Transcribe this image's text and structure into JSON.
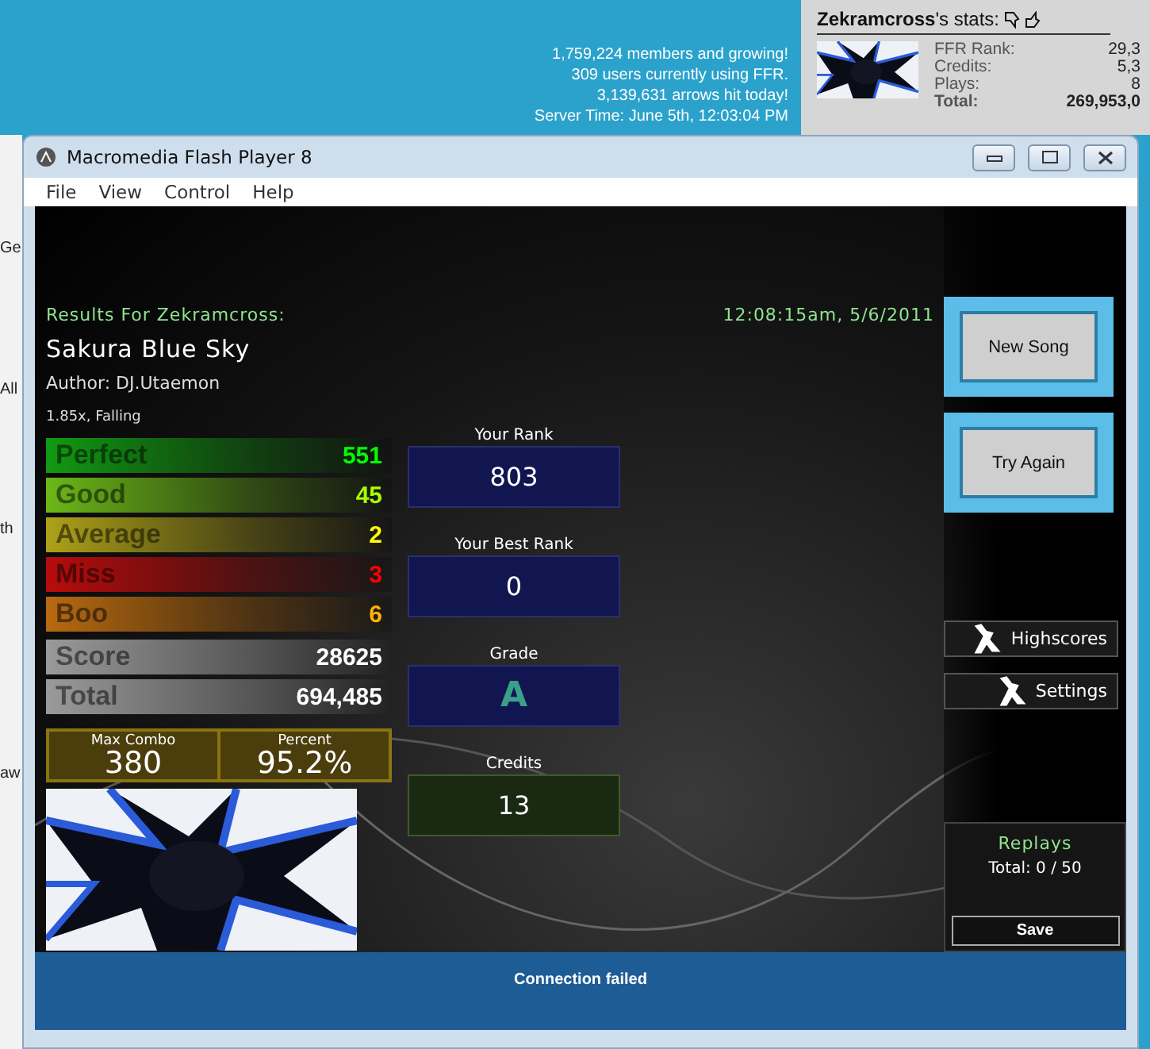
{
  "site": {
    "fragments": [
      "Ge",
      "All",
      "th",
      "aw"
    ],
    "stats_lines": [
      "1,759,224 members and growing!",
      "309 users currently using FFR.",
      "3,139,631 arrows hit today!",
      "Server Time: June 5th, 12:03:04 PM"
    ],
    "user_stats": {
      "username": "Zekramcross",
      "suffix": "'s stats:",
      "rows": [
        {
          "label": "FFR Rank:",
          "value": "29,3",
          "bold": false
        },
        {
          "label": "Credits:",
          "value": "5,3",
          "bold": false
        },
        {
          "label": "Plays:",
          "value": "8",
          "bold": false
        },
        {
          "label": "Total:",
          "value": "269,953,0",
          "bold": true
        }
      ]
    }
  },
  "window": {
    "title": "Macromedia Flash Player 8",
    "menu": [
      "File",
      "View",
      "Control",
      "Help"
    ]
  },
  "game": {
    "results_for": "Results For Zekramcross:",
    "timestamp": "12:08:15am, 5/6/2011",
    "song_title": "Sakura Blue Sky",
    "author": "Author: DJ.Utaemon",
    "settings": "1.85x, Falling",
    "judgments": [
      {
        "label": "Perfect",
        "value": "551",
        "color": "#129a12"
      },
      {
        "label": "Good",
        "value": "45",
        "color": "#6cb818"
      },
      {
        "label": "Average",
        "value": "2",
        "color": "#aea11a"
      },
      {
        "label": "Miss",
        "value": "3",
        "color": "#b80c0c"
      },
      {
        "label": "Boo",
        "value": "6",
        "color": "#b86a10"
      }
    ],
    "totals": [
      {
        "label": "Score",
        "value": "28625"
      },
      {
        "label": "Total",
        "value": "694,485"
      }
    ],
    "summary": [
      {
        "label": "Max Combo",
        "value": "380"
      },
      {
        "label": "Percent",
        "value": "95.2%"
      }
    ],
    "ranks": [
      {
        "label": "Your Rank",
        "value": "803",
        "kind": "rank"
      },
      {
        "label": "Your Best Rank",
        "value": "0",
        "kind": "rank"
      },
      {
        "label": "Grade",
        "value": "A",
        "kind": "grade"
      },
      {
        "label": "Credits",
        "value": "13",
        "kind": "credits"
      }
    ],
    "buttons": [
      {
        "label": "New Song",
        "kind": "large"
      },
      {
        "label": "Try Again",
        "kind": "large"
      },
      {
        "label": "Highscores",
        "kind": "small"
      },
      {
        "label": "Settings",
        "kind": "small"
      }
    ],
    "replays": {
      "title": "Replays",
      "total": "Total: 0 / 50",
      "save": "Save"
    }
  },
  "status_bar": "Connection failed"
}
